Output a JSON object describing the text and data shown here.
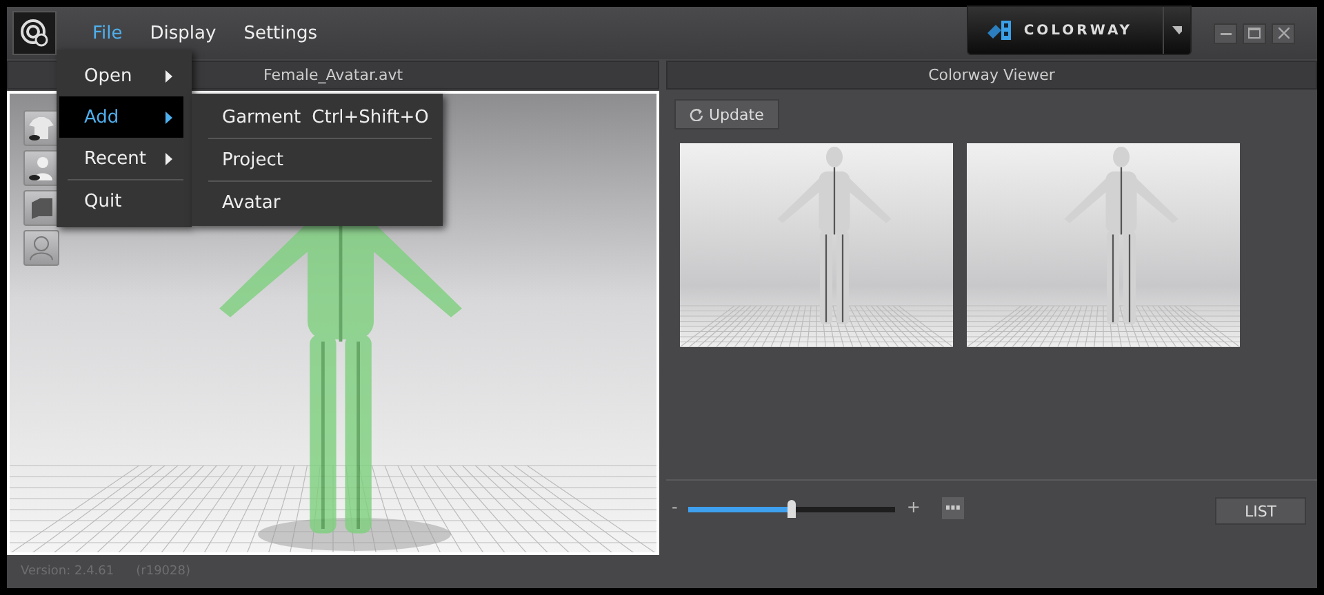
{
  "menubar": [
    {
      "label": "File",
      "selected": true
    },
    {
      "label": "Display",
      "selected": false
    },
    {
      "label": "Settings",
      "selected": false
    }
  ],
  "mode_button": {
    "label": "COLORWAY"
  },
  "left_panel": {
    "title": "Female_Avatar.avt"
  },
  "right_panel": {
    "title": "Colorway Viewer",
    "update_button": "Update"
  },
  "file_menu": [
    {
      "label": "Open",
      "submenu": true,
      "selected": false,
      "separator_before": false
    },
    {
      "label": "Add",
      "submenu": true,
      "selected": true,
      "separator_before": false
    },
    {
      "label": "Recent",
      "submenu": true,
      "selected": false,
      "separator_before": false
    },
    {
      "label": "Quit",
      "submenu": false,
      "selected": false,
      "separator_before": true
    }
  ],
  "add_submenu": [
    {
      "label": "Garment",
      "shortcut": "Ctrl+Shift+O"
    },
    {
      "label": "Project"
    },
    {
      "label": "Avatar"
    }
  ],
  "zoom": {
    "minus": "-",
    "plus": "+",
    "level": 0.5
  },
  "list_button": "LIST",
  "status_bar": {
    "version": "Version: 2.4.61",
    "build": "(r19028)"
  }
}
